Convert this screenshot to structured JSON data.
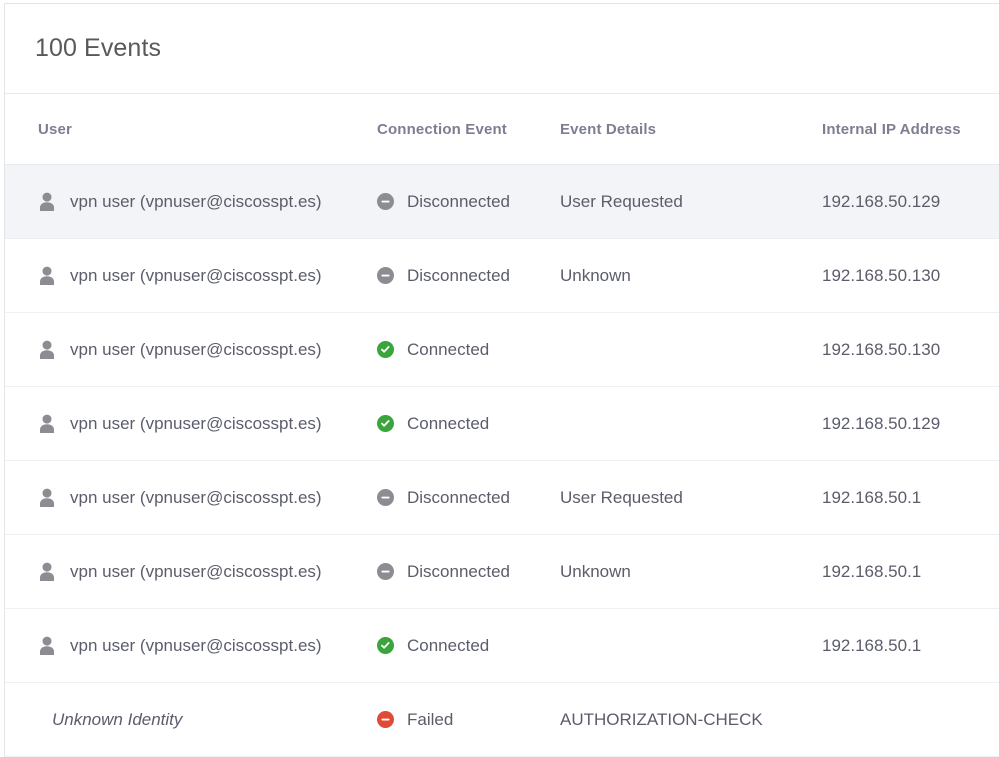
{
  "card": {
    "title": "100 Events"
  },
  "table": {
    "columns": [
      {
        "key": "user",
        "label": "User"
      },
      {
        "key": "conn",
        "label": "Connection Event"
      },
      {
        "key": "details",
        "label": "Event Details"
      },
      {
        "key": "ip",
        "label": "Internal IP Address"
      }
    ],
    "rows": [
      {
        "user": "vpn user (vpnuser@ciscosspt.es)",
        "user_icon": "person-icon",
        "user_italic": false,
        "conn": "Disconnected",
        "conn_icon": "minus-circle-gray-icon",
        "conn_status": "disconnected",
        "details": "User Requested",
        "ip": "192.168.50.129",
        "selected": true
      },
      {
        "user": "vpn user (vpnuser@ciscosspt.es)",
        "user_icon": "person-icon",
        "user_italic": false,
        "conn": "Disconnected",
        "conn_icon": "minus-circle-gray-icon",
        "conn_status": "disconnected",
        "details": "Unknown",
        "ip": "192.168.50.130",
        "selected": false
      },
      {
        "user": "vpn user (vpnuser@ciscosspt.es)",
        "user_icon": "person-icon",
        "user_italic": false,
        "conn": "Connected",
        "conn_icon": "check-circle-green-icon",
        "conn_status": "connected",
        "details": "",
        "ip": "192.168.50.130",
        "selected": false
      },
      {
        "user": "vpn user (vpnuser@ciscosspt.es)",
        "user_icon": "person-icon",
        "user_italic": false,
        "conn": "Connected",
        "conn_icon": "check-circle-green-icon",
        "conn_status": "connected",
        "details": "",
        "ip": "192.168.50.129",
        "selected": false
      },
      {
        "user": "vpn user (vpnuser@ciscosspt.es)",
        "user_icon": "person-icon",
        "user_italic": false,
        "conn": "Disconnected",
        "conn_icon": "minus-circle-gray-icon",
        "conn_status": "disconnected",
        "details": "User Requested",
        "ip": "192.168.50.1",
        "selected": false
      },
      {
        "user": "vpn user (vpnuser@ciscosspt.es)",
        "user_icon": "person-icon",
        "user_italic": false,
        "conn": "Disconnected",
        "conn_icon": "minus-circle-gray-icon",
        "conn_status": "disconnected",
        "details": "Unknown",
        "ip": "192.168.50.1",
        "selected": false
      },
      {
        "user": "vpn user (vpnuser@ciscosspt.es)",
        "user_icon": "person-icon",
        "user_italic": false,
        "conn": "Connected",
        "conn_icon": "check-circle-green-icon",
        "conn_status": "connected",
        "details": "",
        "ip": "192.168.50.1",
        "selected": false
      },
      {
        "user": "Unknown Identity",
        "user_icon": "",
        "user_italic": true,
        "conn": "Failed",
        "conn_icon": "minus-circle-red-icon",
        "conn_status": "failed",
        "details": "AUTHORIZATION-CHECK",
        "ip": "",
        "selected": false
      }
    ]
  },
  "colors": {
    "status_connected": "#38a63a",
    "status_disconnected": "#8b8d93",
    "status_failed": "#e04b35",
    "text_primary": "#5b5d6b",
    "text_header": "#7d7f91",
    "row_selected_bg": "#f3f4f7",
    "divider": "#eef0f2"
  }
}
